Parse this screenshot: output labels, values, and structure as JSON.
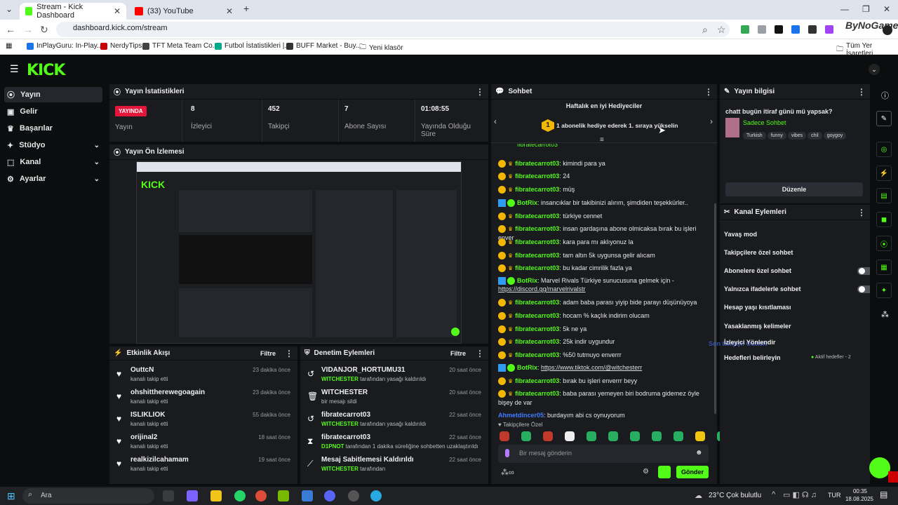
{
  "browser": {
    "tabs": [
      {
        "title": "Stream - Kick Dashboard"
      },
      {
        "title": "(33) YouTube"
      }
    ],
    "url": "dashboard.kick.com/stream",
    "bookmarks": [
      "InPlayGuru: In-Play...",
      "NerdyTips",
      "TFT Meta Team Co...",
      "Futbol İstatistikleri |...",
      "BUFF Market - Buy...",
      "Yeni klasör"
    ],
    "all_bookmarks": "Tüm Yer İşaretleri",
    "watermark": "ByNoGame"
  },
  "sidebar": {
    "items": [
      {
        "label": "Yayın",
        "icon": "broadcast-icon"
      },
      {
        "label": "Gelir",
        "icon": "dollar-icon"
      },
      {
        "label": "Başarılar",
        "icon": "trophy-icon"
      },
      {
        "label": "Stüdyo",
        "icon": "studio-icon"
      },
      {
        "label": "Kanal",
        "icon": "channel-icon"
      },
      {
        "label": "Ayarlar",
        "icon": "gear-icon"
      }
    ]
  },
  "stats": {
    "title": "Yayın İstatistikleri",
    "badge": "YAYINDA",
    "status_label": "Yayın",
    "items": [
      {
        "value": "8",
        "label": "İzleyici"
      },
      {
        "value": "452",
        "label": "Takipçi"
      },
      {
        "value": "7",
        "label": "Abone Sayısı"
      },
      {
        "value": "01:08:55",
        "label": "Yayında Olduğu Süre"
      }
    ]
  },
  "preview": {
    "title": "Yayın Ön İzlemesi"
  },
  "activity": {
    "title": "Etkinlik Akışı",
    "filter": "Filtre",
    "items": [
      {
        "name": "OuttcN",
        "sub": "kanalı takip etti",
        "time": "23 dakika önce"
      },
      {
        "name": "ohshittherewegoagain",
        "sub": "kanalı takip etti",
        "time": "23 dakika önce"
      },
      {
        "name": "ISLIKLIOK",
        "sub": "kanalı takip etti",
        "time": "55 dakika önce"
      },
      {
        "name": "orijinal2",
        "sub": "kanalı takip etti",
        "time": "18 saat önce"
      },
      {
        "name": "realkizilcahamam",
        "sub": "kanalı takip etti",
        "time": "19 saat önce"
      }
    ]
  },
  "moderation": {
    "title": "Denetim Eylemleri",
    "filter": "Filtre",
    "items": [
      {
        "name": "VIDANJOR_HORTUMU31",
        "actor": "WITCHESTER",
        "rest": " tarafından yasağı kaldırıldı",
        "time": "20 saat önce"
      },
      {
        "name": "WITCHESTER",
        "actor": "",
        "rest": "bir mesajı sildi",
        "time": "20 saat önce"
      },
      {
        "name": "fibratecarrot03",
        "actor": "WITCHESTER",
        "rest": " tarafından yasağı kaldırıldı",
        "time": "22 saat önce"
      },
      {
        "name": "fibratecarrot03",
        "actor": "D1PNOT",
        "rest": " tarafından 1 dakika süreliğine sohbetten uzaklaştırıldı",
        "time": "22 saat önce"
      },
      {
        "name": "Mesaj Sabitlemesi Kaldırıldı",
        "actor": "WITCHESTER",
        "rest": " tarafından",
        "time": "22 saat önce"
      }
    ]
  },
  "chat": {
    "title": "Sohbet",
    "gifters_title": "Haftalık en iyi Hediyeciler",
    "gift_rank": "1",
    "gift_text": "1 abonelik hediye ederek 1. sıraya yükselin",
    "messages": [
      {
        "user": "fibratecarrot03",
        "text": "kimindi para ya",
        "type": "user"
      },
      {
        "user": "fibratecarrot03",
        "text": "24",
        "type": "user"
      },
      {
        "user": "fibratecarrot03",
        "text": "müş",
        "type": "user"
      },
      {
        "user": "BotRix",
        "text": "insancıklar bir takibinizi alırım, şimdiden teşekkürler..",
        "type": "bot"
      },
      {
        "user": "fibratecarrot03",
        "text": "türkiye cennet",
        "type": "user"
      },
      {
        "user": "fibratecarrot03",
        "text": "insan gardaşına abone olmicaksa bırak bu işleri enver",
        "type": "user"
      },
      {
        "user": "fibratecarrot03",
        "text": "kara para mı aklıyonuz la",
        "type": "user"
      },
      {
        "user": "fibratecarrot03",
        "text": "tam altın 5k uygunsa gelir alıcam",
        "type": "user"
      },
      {
        "user": "fibratecarrot03",
        "text": "bu kadar cimrilik fazla ya",
        "type": "user"
      },
      {
        "user": "BotRix",
        "text": "Marvel Rivals Türkiye sunucusuna gelmek için - ",
        "link": "https://discord.gg/marvelrivalstr",
        "type": "bot"
      },
      {
        "user": "fibratecarrot03",
        "text": "adam baba parası yiyip bide parayı düşünüyoya",
        "type": "user"
      },
      {
        "user": "fibratecarrot03",
        "text": "hocam % kaçlık indirim olucam",
        "type": "user"
      },
      {
        "user": "fibratecarrot03",
        "text": "5k ne ya",
        "type": "user"
      },
      {
        "user": "fibratecarrot03",
        "text": "25k indir uygundur",
        "type": "user"
      },
      {
        "user": "fibratecarrot03",
        "text": "%50 tutmuyo enverrr",
        "type": "user"
      },
      {
        "user": "BotRix",
        "text": "",
        "link": "https://www.tiktok.com/@witchesterr",
        "type": "bot"
      },
      {
        "user": "fibratecarrot03",
        "text": "bırak bu işleri enverrr beyy",
        "type": "user"
      },
      {
        "user": "fibratecarrot03",
        "text": "baba parası yemeyen biri bodruma gidemez öyle bişey de var",
        "type": "user"
      },
      {
        "user": "Ahmetdincer05",
        "text": "burdayım abi cs oynuyorum",
        "type": "plain"
      }
    ],
    "emote_label": "Takipçilere Özel",
    "input_placeholder": "Bir mesaj gönderin",
    "send": "Gönder"
  },
  "info": {
    "title": "Yayın bilgisi",
    "stream_title": "chatt bugün itiraf günü mü yapsak?",
    "category": "Sadece Sohbet",
    "tags": [
      "Turkish",
      "funny",
      "vibes",
      "chil",
      "goygoy"
    ],
    "edit": "Düzenle"
  },
  "channel_actions": {
    "title": "Kanal Eylemleri",
    "items": [
      {
        "label": "Yavaş mod",
        "kind": "arrow"
      },
      {
        "label": "Takipçilere özel sohbet",
        "kind": "arrow"
      },
      {
        "label": "Abonelere özel sohbet",
        "kind": "toggle"
      },
      {
        "label": "Yalnızca ifadelerle sohbet",
        "kind": "toggle"
      },
      {
        "label": "Hesap yaşı kısıtlaması",
        "kind": "arrow"
      },
      {
        "label": "Yasaklanmış kelimeler",
        "kind": "arrow"
      },
      {
        "label": "Hedefleri belirleyin",
        "kind": "arrow"
      }
    ],
    "overlay_text": "Son takipçi: OuttcN",
    "overlay2": "İzleyici Yönlendir",
    "goals_status": "Aktif hedefler - 2"
  },
  "taskbar": {
    "search": "Ara",
    "weather": "23°C  Çok bulutlu",
    "lang": "TUR",
    "time": "00:35",
    "date": "18.08.2025"
  }
}
